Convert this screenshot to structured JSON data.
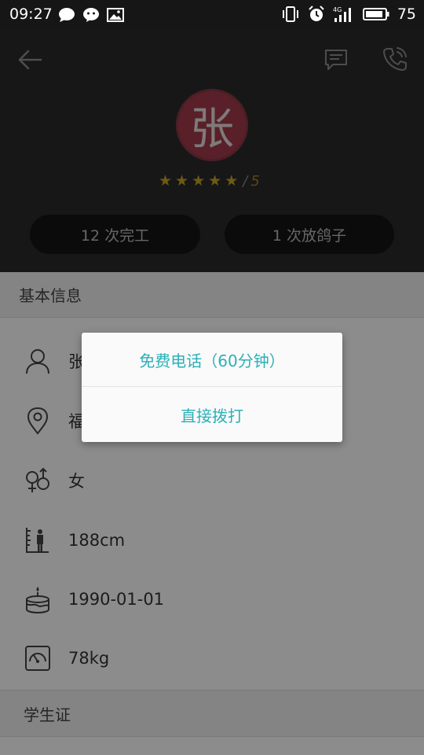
{
  "status_bar": {
    "time": "09:27",
    "battery_level": "75",
    "network": "4G"
  },
  "header": {
    "avatar_text": "张",
    "rating": {
      "stars": 5,
      "separator": "/",
      "max": "5"
    },
    "stats": {
      "completed": "12 次完工",
      "flaked": "1 次放鸽子"
    }
  },
  "basic_info": {
    "title": "基本信息",
    "name_partial": "张",
    "location_partial": "福",
    "gender": "女",
    "height": "188cm",
    "birthday": "1990-01-01",
    "weight": "78kg"
  },
  "student_id": {
    "title": "学生证"
  },
  "dialog": {
    "free_call": "免费电话（60分钟）",
    "direct_call": "直接拨打"
  },
  "colors": {
    "accent": "#2bb0b8",
    "avatar_bg": "#a23b4b",
    "star": "#c9a227",
    "header_bg": "#2a2a2a"
  }
}
